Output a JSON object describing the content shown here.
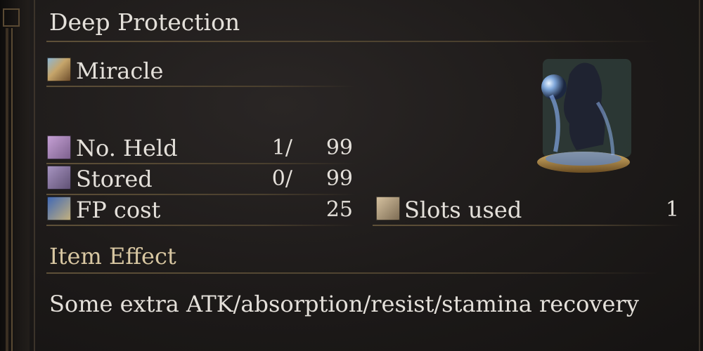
{
  "item": {
    "name": "Deep Protection",
    "category": "Miracle"
  },
  "stats": {
    "held": {
      "label": "No. Held",
      "current": "1/",
      "max": "99"
    },
    "stored": {
      "label": "Stored",
      "current": "0/",
      "max": "99"
    },
    "fp_cost": {
      "label": "FP cost",
      "value": "25"
    },
    "slots_used": {
      "label": "Slots used",
      "value": "1"
    }
  },
  "effect": {
    "header": "Item Effect",
    "text": "Some extra ATK/absorption/resist/stamina recovery"
  },
  "icons": {
    "category_icon": "miracle-icon",
    "held_icon": "pouch-icon",
    "stored_icon": "chest-icon",
    "fp_icon": "fp-icon",
    "slots_icon": "attunement-icon",
    "art": "miracle-portrait"
  }
}
